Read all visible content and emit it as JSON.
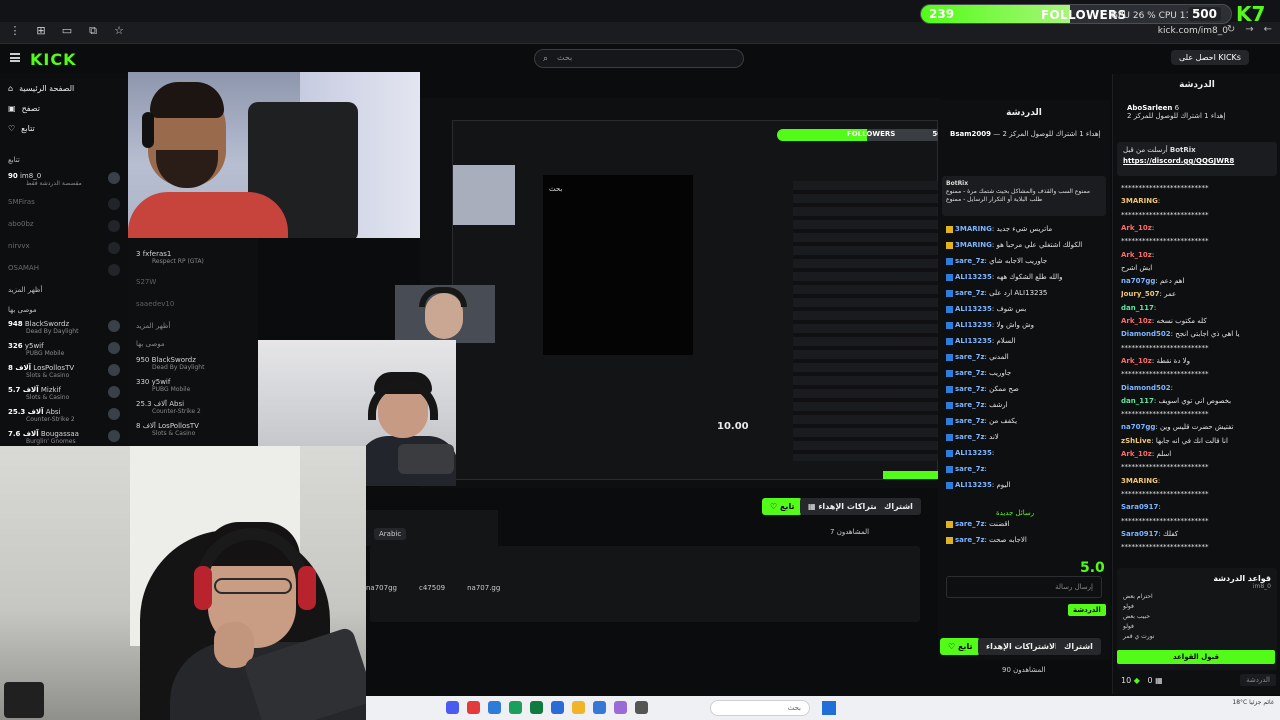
{
  "browser": {
    "url": "kick.com/im8_0",
    "nav_icons": [
      "menu-icon",
      "tab-icon",
      "sidebar-icon",
      "star-icon"
    ]
  },
  "goal": {
    "start": "239",
    "label": "FOLLOWERS",
    "stats": "GPU 26 % CPU 11",
    "end": "500",
    "progress": 0.48,
    "k7": "K7"
  },
  "header": {
    "logo": "KICK",
    "search_placeholder": "بحث",
    "get_kicks": "احصل على KICKs"
  },
  "sidebar": {
    "nav": [
      "الصفحة الرئيسية",
      "تصفح",
      "تتابع"
    ],
    "following_header": "تتابع",
    "channels": [
      {
        "count": "90",
        "name": "im8_0",
        "sub": "مقصصة الدردشة فقط"
      },
      {
        "count": "",
        "name": "SMFiras",
        "sub": ""
      },
      {
        "count": "",
        "name": "abo0bz",
        "sub": ""
      },
      {
        "count": "",
        "name": "nirvvx",
        "sub": ""
      },
      {
        "count": "",
        "name": "OSAMAH",
        "sub": ""
      }
    ],
    "show_more": "أظهر المزيد",
    "recommended_header": "موصى بها",
    "recommended": [
      {
        "count": "948",
        "name": "BlackSwordz",
        "sub": "Dead By Daylight"
      },
      {
        "count": "326",
        "name": "y5wif",
        "sub": "PUBG Mobile"
      },
      {
        "count": "8 آلاف",
        "name": "LosPollosTV",
        "sub": "Slots & Casino"
      },
      {
        "count": "5.7 آلاف",
        "name": "Mizkif",
        "sub": "Slots & Casino"
      },
      {
        "count": "25.3 آلاف",
        "name": "Absi",
        "sub": "Counter-Strike 2"
      },
      {
        "count": "7.6 آلاف",
        "name": "Bougassaa",
        "sub": "Burglin' Gnomes"
      }
    ]
  },
  "echo_sidebar": [
    {
      "count": "3",
      "name": "fxferas1",
      "sub": "Respect RP (GTA)"
    },
    {
      "count": "",
      "name": "S27W",
      "sub": ""
    },
    {
      "count": "",
      "name": "saaedev10",
      "sub": ""
    },
    {
      "count": "",
      "name": "أظهر المزيد",
      "sub": ""
    },
    {
      "count": "",
      "name": "موصى بها",
      "sub": ""
    },
    {
      "count": "950",
      "name": "BlackSwordz",
      "sub": "Dead By Daylight"
    },
    {
      "count": "330",
      "name": "y5wif",
      "sub": "PUBG Mobile"
    },
    {
      "count": "25.3 آلاف",
      "name": "Absi",
      "sub": "Counter-Strike 2"
    },
    {
      "count": "8 آلاف",
      "name": "LosPollosTV",
      "sub": "Slots & Casino"
    }
  ],
  "stream": {
    "inner_search": "بحث",
    "inner_goal_label": "FOLLOWERS",
    "inner_goal_end": "500",
    "inner_goal_start": "239",
    "inner_goal_progress": 0.48,
    "price": "10.00"
  },
  "chat1": {
    "title": "الدردشة",
    "get_kicks": "احصل على KICKs",
    "pinned_user": "Bsam2009",
    "pinned_text": "إهداء 1 اشتراك للوصول المركز 2",
    "bot_user": "BotRix",
    "bot_text": "ممنوع السب والقذف والمشاكل بحيث شتمك مرة - ممنوع طلب البلاية أو التكرار الرسايل - ممنوع",
    "messages": [
      {
        "user": "3MARING",
        "text": "ماتريس شيء جديد",
        "badge": "y"
      },
      {
        "user": "3MARING",
        "text": "الكولك اشتغلي علي مرحباً هو",
        "badge": "y"
      },
      {
        "user": "sare_7z",
        "text": "جاوريب الاجابه شاي",
        "badge": "b"
      },
      {
        "user": "ALI13235",
        "text": "والله طلع الشكوك ههه",
        "badge": "b"
      },
      {
        "user": "sare_7z",
        "text": "ارد على ALI13235",
        "badge": "b"
      },
      {
        "user": "ALI13235",
        "text": "بس شوف",
        "badge": "b"
      },
      {
        "user": "ALI13235",
        "text": "وش واش ولا",
        "badge": "b"
      },
      {
        "user": "ALI13235",
        "text": "السلام",
        "badge": "b"
      },
      {
        "user": "sare_7z",
        "text": "المدني",
        "badge": "b"
      },
      {
        "user": "sare_7z",
        "text": "جاوريب",
        "badge": "b"
      },
      {
        "user": "sare_7z",
        "text": "صح ممكن",
        "badge": "b"
      },
      {
        "user": "sare_7z",
        "text": "ارشف",
        "badge": "b"
      },
      {
        "user": "sare_7z",
        "text": "يكفف من",
        "badge": "b"
      },
      {
        "user": "sare_7z",
        "text": "لاند",
        "badge": "b"
      },
      {
        "user": "ALI13235",
        "text": "",
        "badge": "b"
      },
      {
        "user": "sare_7z",
        "text": "",
        "badge": "b"
      },
      {
        "user": "ALI13235",
        "text": "اليوم",
        "badge": "b"
      }
    ],
    "new_messages": "رسائل جديدة",
    "after_new": [
      {
        "user": "sare_7z",
        "text": "اقضنت",
        "badge": "y"
      },
      {
        "user": "sare_7z",
        "text": "الاجابه صحت",
        "badge": "y"
      }
    ],
    "input_placeholder": "إرسال رسالة",
    "send": "الدردشة",
    "big_number": "5.0"
  },
  "info": {
    "follow": "تابع",
    "subscriptions": "الاشتراكات الإهداء",
    "subscribe": "اشتراك",
    "viewers_label": "المشاهدون",
    "viewers": "7",
    "language": "Arabic",
    "socials": [
      "na707gg",
      "c47509",
      "na707.gg"
    ]
  },
  "outer_actions": {
    "follow": "تابع",
    "subscriptions": "الاشتراكات الإهداء",
    "subscribe": "اشتراك",
    "viewers_label": "المشاهدون",
    "viewers": "90"
  },
  "chat2": {
    "title": "الدردشة",
    "pinned_user": "AboSarleen",
    "pinned_count": "6",
    "pinned_text": "إهداء 1 اشتراك للوصول للمركز 2",
    "bot_header": "أرسلت من قبل",
    "bot_user": "BotRix",
    "bot_link": "https://discord.gg/QQGJWR8",
    "messages": [
      {
        "user": "",
        "text": "*************************",
        "cls": ""
      },
      {
        "user": "3MARING",
        "text": "",
        "cls": "y"
      },
      {
        "user": "",
        "text": "*************************",
        "cls": ""
      },
      {
        "user": "Ark_10z",
        "text": "",
        "cls": ""
      },
      {
        "user": "",
        "text": "*************************",
        "cls": ""
      },
      {
        "user": "Ark_10z",
        "text": "",
        "cls": ""
      },
      {
        "user": "",
        "text": "ايش اشرح",
        "cls": ""
      },
      {
        "user": "na707gg",
        "text": "اهم دعم",
        "cls": "b"
      },
      {
        "user": "Joury_507",
        "text": "عمر",
        "cls": "y"
      },
      {
        "user": "dan_117",
        "text": "",
        "cls": "g"
      },
      {
        "user": "Ark_10z",
        "text": "كله مكتوب نسخه",
        "cls": ""
      },
      {
        "user": "Diamond502",
        "text": "يا اهي ذي اجابتي انجح",
        "cls": "b"
      },
      {
        "user": "",
        "text": "*************************",
        "cls": ""
      },
      {
        "user": "Ark_10z",
        "text": "ولا دة نقطة",
        "cls": ""
      },
      {
        "user": "",
        "text": "*************************",
        "cls": ""
      },
      {
        "user": "Diamond502",
        "text": "",
        "cls": "b"
      },
      {
        "user": "dan_117",
        "text": "بخصوص اني توي اسويف",
        "cls": "g"
      },
      {
        "user": "",
        "text": "*************************",
        "cls": ""
      },
      {
        "user": "na707gg",
        "text": "تفتيش حضرت قليس وين",
        "cls": "b"
      },
      {
        "user": "zShLive",
        "text": "انا قالت انك في انه جابها",
        "cls": "y"
      },
      {
        "user": "Ark_10z",
        "text": "اسلم",
        "cls": ""
      },
      {
        "user": "",
        "text": "*************************",
        "cls": ""
      },
      {
        "user": "3MARING",
        "text": "",
        "cls": "y"
      },
      {
        "user": "",
        "text": "*************************",
        "cls": ""
      },
      {
        "user": "Sara0917",
        "text": "",
        "cls": "b"
      },
      {
        "user": "",
        "text": "*************************",
        "cls": ""
      },
      {
        "user": "Sara0917",
        "text": "كفلك",
        "cls": "b"
      },
      {
        "user": "",
        "text": "*************************",
        "cls": ""
      }
    ],
    "rules_title": "قواعد الدردشة",
    "rules_sub": "im8_0",
    "rules": [
      "احترام بعض",
      "فولو",
      "حبيب بعض",
      "فولو",
      "نورت ي قمر"
    ],
    "accept": "قبول القواعد",
    "kicks": "10",
    "points": "0",
    "chat_btn": "الدردشة"
  },
  "taskbar": {
    "search": "بحث",
    "weather": "18°C غائم جزئيا",
    "icon_colors": [
      "#4a5cf0",
      "#e33b3b",
      "#2e7bd8",
      "#1aa05a",
      "#0f7b3f",
      "#2b6bd6",
      "#f0b429",
      "#3778d6",
      "#9a6bd6",
      "#555"
    ]
  }
}
